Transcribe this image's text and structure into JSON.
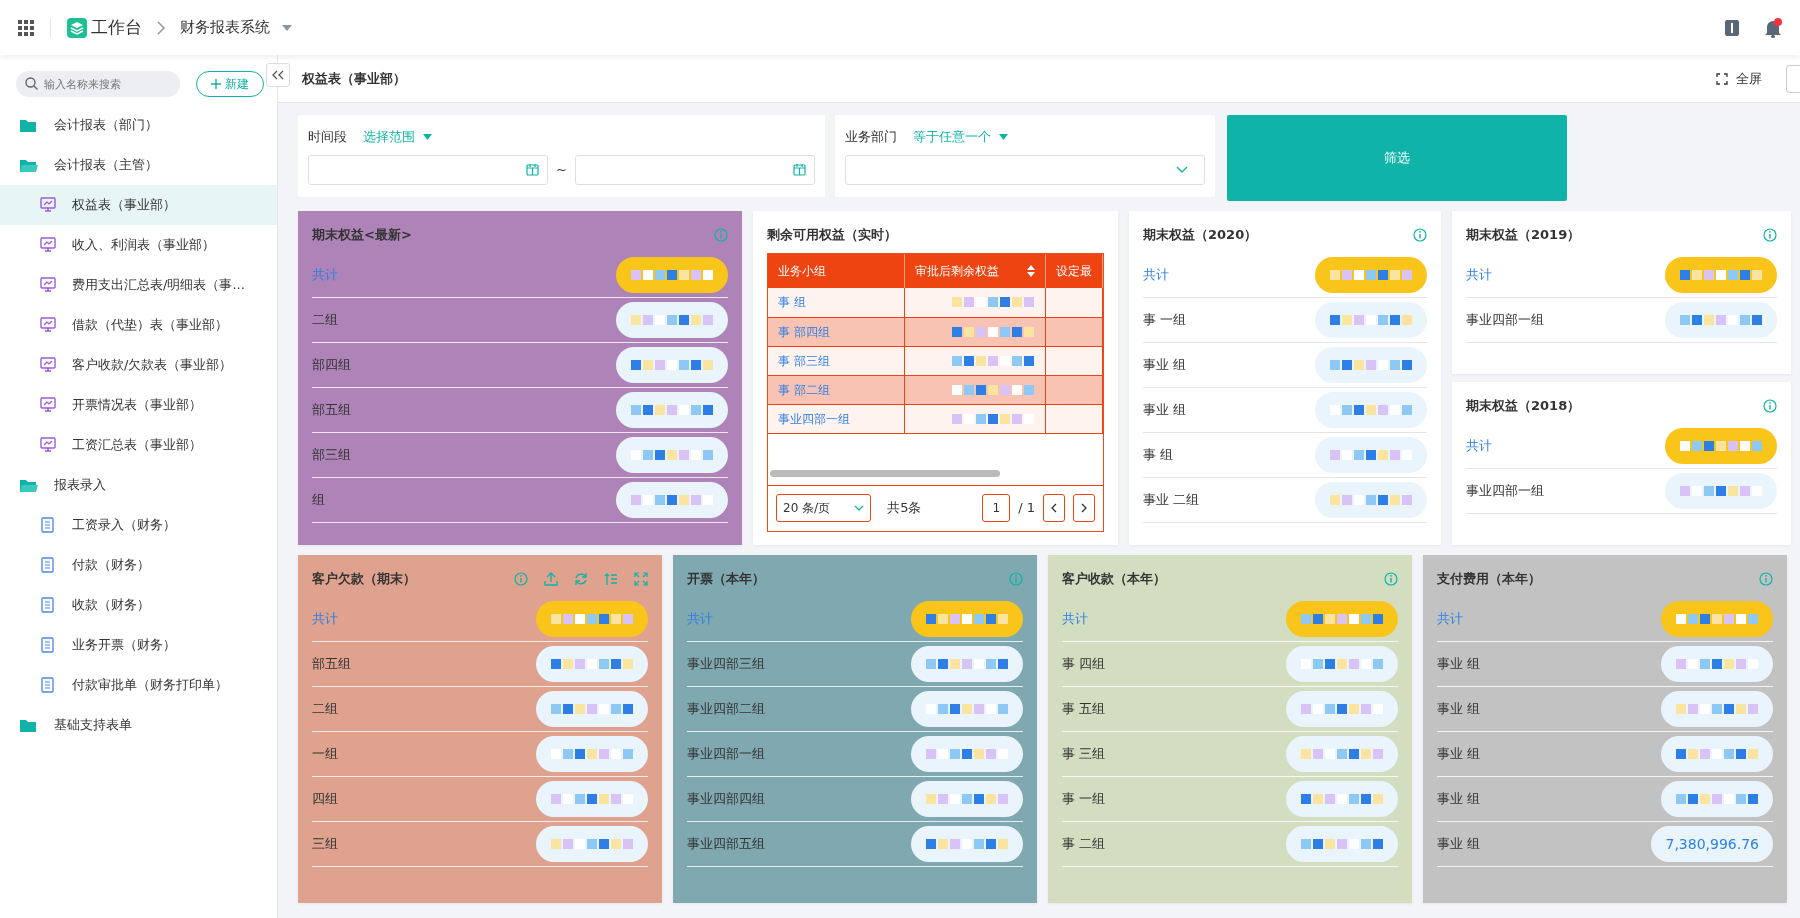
{
  "topbar": {
    "app": "工作台",
    "system": "财务报表系统",
    "has_notification": true
  },
  "sidebar": {
    "search": {
      "placeholder": "输入名称来搜索"
    },
    "new_button": "新建",
    "items": [
      {
        "label": "会计报表（部门）",
        "expanded": false
      },
      {
        "label": "会计报表（主管）",
        "expanded": true,
        "children": [
          {
            "label": "权益表（事业部）",
            "kind": "report",
            "selected": true
          },
          {
            "label": "收入、利润表（事业部）",
            "kind": "report",
            "selected": false
          },
          {
            "label": "费用支出汇总表/明细表（事...",
            "kind": "report",
            "selected": false
          },
          {
            "label": "借款（代垫）表（事业部）",
            "kind": "report",
            "selected": false
          },
          {
            "label": "客户收款/欠款表（事业部）",
            "kind": "report",
            "selected": false
          },
          {
            "label": "开票情况表（事业部）",
            "kind": "report",
            "selected": false
          },
          {
            "label": "工资汇总表（事业部）",
            "kind": "report",
            "selected": false
          }
        ]
      },
      {
        "label": "报表录入",
        "expanded": true,
        "children": [
          {
            "label": "工资录入（财务）",
            "kind": "form",
            "selected": false
          },
          {
            "label": "付款（财务）",
            "kind": "form",
            "selected": false
          },
          {
            "label": "收款（财务）",
            "kind": "form",
            "selected": false
          },
          {
            "label": "业务开票（财务）",
            "kind": "form",
            "selected": false
          },
          {
            "label": "付款审批单（财务打印单）",
            "kind": "form",
            "selected": false
          }
        ]
      },
      {
        "label": "基础支持表单",
        "expanded": false
      }
    ]
  },
  "page": {
    "title": "权益表（事业部）",
    "fullscreen": "全屏"
  },
  "filters": [
    {
      "label": "时间段",
      "mode": "选择范围",
      "kind": "date_range",
      "separator": "~"
    },
    {
      "label": "业务部门",
      "mode": "等于任意一个",
      "kind": "select"
    }
  ],
  "filter_button": "筛选",
  "top_row": [
    {
      "kind": "list",
      "title": "期末权益<最新>",
      "color": "#ae84b8",
      "tools": false,
      "total_label": "共计",
      "rows": [
        {
          "label": "二组",
          "redacted": true
        },
        {
          "label": "部四组",
          "redacted": true
        },
        {
          "label": "部五组",
          "redacted": true
        },
        {
          "label": "部三组",
          "redacted": true
        },
        {
          "label": "组",
          "redacted": true
        }
      ]
    },
    {
      "kind": "table",
      "title": "剩余可用权益（实时）",
      "color": "#ffffff",
      "columns": [
        "业务小组",
        "审批后剩余权益",
        "设定最"
      ],
      "rows": [
        {
          "group": "事 组",
          "highlighted": false,
          "redacted": true
        },
        {
          "group": "事 部四组",
          "highlighted": true,
          "redacted": true
        },
        {
          "group": "事 部三组",
          "highlighted": false,
          "redacted": true
        },
        {
          "group": "事 部二组",
          "highlighted": true,
          "redacted": true
        },
        {
          "group": "事业四部一组",
          "highlighted": false,
          "redacted": true
        }
      ],
      "pagination": {
        "page_size": "20 条/页",
        "total": "共5条",
        "page": "1",
        "pages": "/ 1"
      }
    },
    {
      "kind": "list",
      "title": "期末权益（2020）",
      "color": "#ffffff",
      "tools": false,
      "total_label": "共计",
      "rows": [
        {
          "label": "事 一组",
          "redacted": true
        },
        {
          "label": "事业 组",
          "redacted": true
        },
        {
          "label": "事业 组",
          "redacted": true
        },
        {
          "label": "事 组",
          "redacted": true
        },
        {
          "label": "事业 二组",
          "redacted": true
        }
      ]
    },
    {
      "kind": "stack",
      "cards": [
        {
          "kind": "list",
          "title": "期末权益（2019）",
          "color": "#ffffff",
          "tools": false,
          "total_label": "共计",
          "rows": [
            {
              "label": "事业四部一组",
              "redacted": true
            }
          ]
        },
        {
          "kind": "list",
          "title": "期末权益（2018）",
          "color": "#ffffff",
          "tools": false,
          "total_label": "共计",
          "rows": [
            {
              "label": "事业四部一组",
              "redacted": true
            }
          ]
        }
      ]
    }
  ],
  "bottom_row": [
    {
      "kind": "list",
      "title": "客户欠款（期末）",
      "color": "#dea28e",
      "tools": true,
      "total_label": "共计",
      "rows": [
        {
          "label": "部五组",
          "redacted": true
        },
        {
          "label": "二组",
          "redacted": true
        },
        {
          "label": "一组",
          "redacted": true
        },
        {
          "label": "四组",
          "redacted": true
        },
        {
          "label": "三组",
          "redacted": true
        }
      ]
    },
    {
      "kind": "list",
      "title": "开票（本年）",
      "color": "#7fa8b0",
      "tools": false,
      "total_label": "共计",
      "rows": [
        {
          "label": "事业四部三组",
          "redacted": true
        },
        {
          "label": "事业四部二组",
          "redacted": true
        },
        {
          "label": "事业四部一组",
          "redacted": true
        },
        {
          "label": "事业四部四组",
          "redacted": true
        },
        {
          "label": "事业四部五组",
          "redacted": true
        }
      ]
    },
    {
      "kind": "list",
      "title": "客户收款（本年）",
      "color": "#d3ddc0",
      "tools": false,
      "total_label": "共计",
      "rows": [
        {
          "label": "事 四组",
          "redacted": true
        },
        {
          "label": "事 五组",
          "redacted": true
        },
        {
          "label": "事 三组",
          "redacted": true
        },
        {
          "label": "事 一组",
          "redacted": true
        },
        {
          "label": "事 二组",
          "redacted": true
        }
      ]
    },
    {
      "kind": "list",
      "title": "支付费用（本年）",
      "color": "#c2c2c2",
      "tools": false,
      "total_label": "共计",
      "rows": [
        {
          "label": "事业 组",
          "redacted": true
        },
        {
          "label": "事业 组",
          "redacted": true
        },
        {
          "label": "事业 组",
          "redacted": true
        },
        {
          "label": "事业 组",
          "redacted": true
        },
        {
          "label": "事业 组",
          "redacted": false,
          "value": "7,380,996.76"
        }
      ]
    }
  ]
}
